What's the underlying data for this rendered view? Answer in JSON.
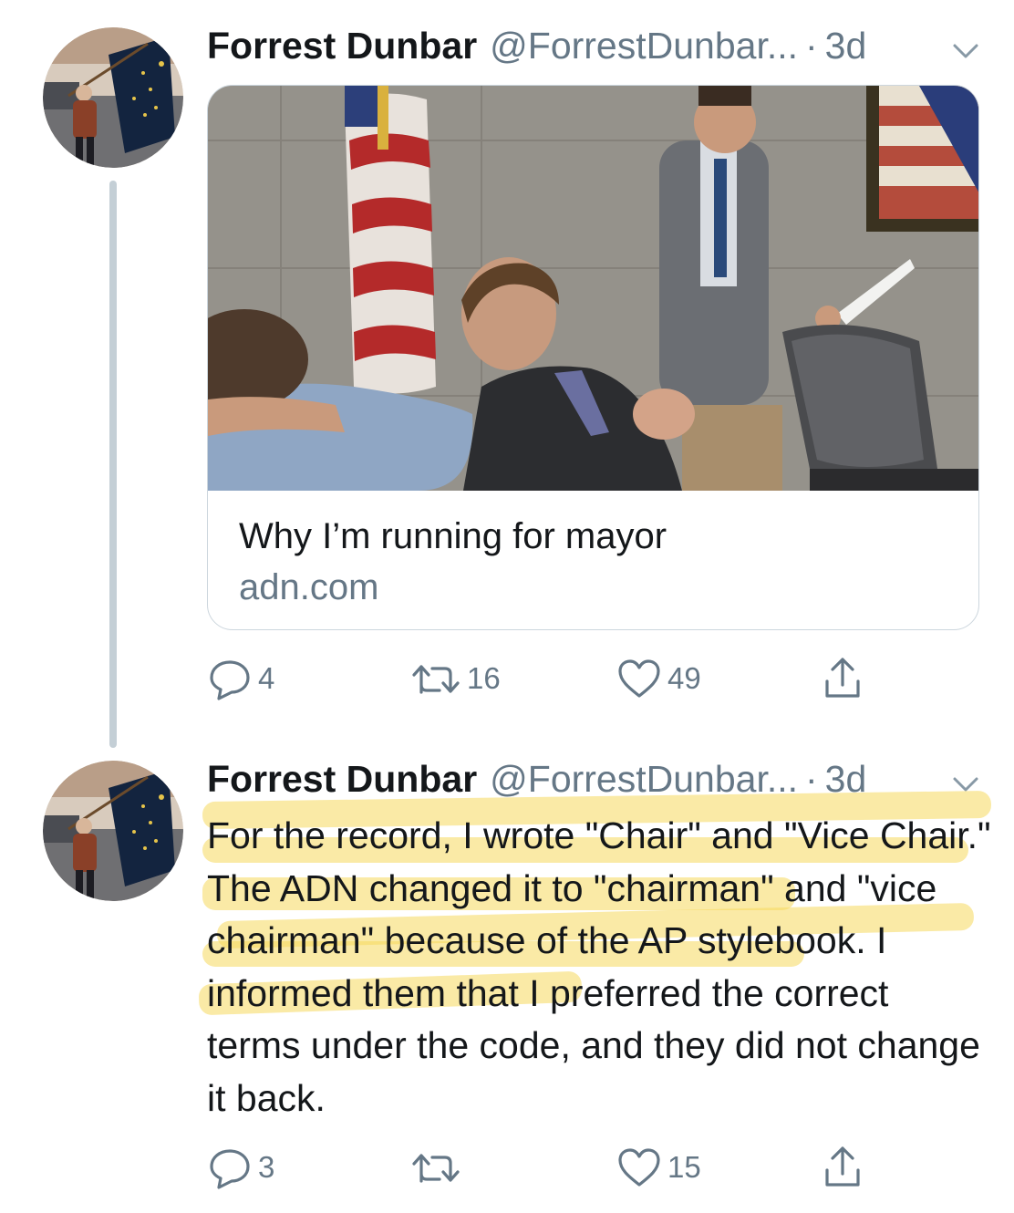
{
  "tweets": [
    {
      "author": {
        "name": "Forrest Dunbar",
        "handle": "@ForrestDunbar...",
        "time": "3d"
      },
      "link_card": {
        "title": "Why I’m running for mayor",
        "domain": "adn.com"
      },
      "actions": {
        "replies": "4",
        "retweets": "16",
        "likes": "49"
      }
    },
    {
      "author": {
        "name": "Forrest Dunbar",
        "handle": "@ForrestDunbar...",
        "time": "3d"
      },
      "text": "For the record, I wrote \"Chair\" and \"Vice Chair.\" The ADN changed it to \"chairman\" and \"vice chairman\" because of the AP stylebook. I informed them that I preferred the correct terms under the code, and they did not change it back.",
      "actions": {
        "replies": "3",
        "retweets": "",
        "likes": "15"
      }
    }
  ],
  "separator": "·",
  "icons": {
    "reply": "reply-icon",
    "retweet": "retweet-icon",
    "like": "heart-icon",
    "share": "share-icon",
    "menu": "chevron-down-icon"
  },
  "colors": {
    "secondary_text": "#657786",
    "thread_line": "#c4cfd6",
    "highlight": "#f6d85c"
  }
}
